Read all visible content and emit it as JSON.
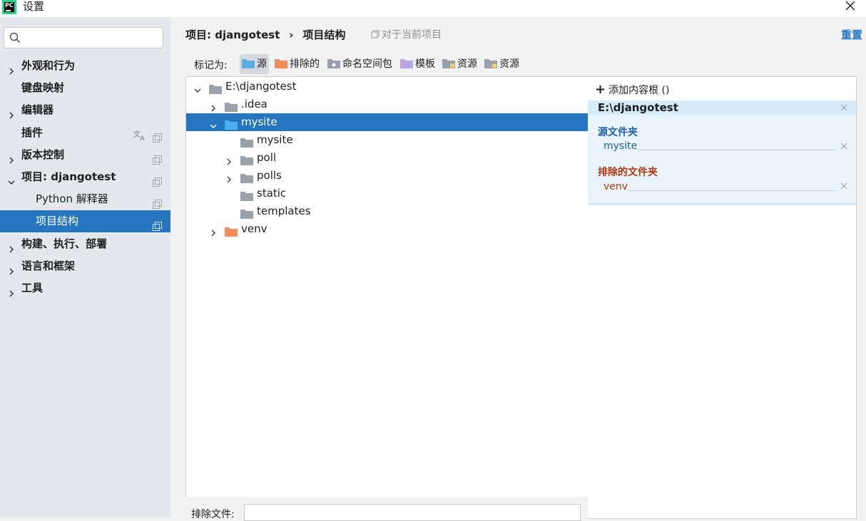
{
  "window": {
    "title": "设置"
  },
  "colors": {
    "accent": "#2675bf",
    "source_folder": "#3a97d4",
    "excluded_folder": "#f08d5a",
    "plain_folder": "#9aa1a8",
    "template_folder": "#b39ddb"
  },
  "sidebar": {
    "search_placeholder": "",
    "items": [
      {
        "label": "外观和行为",
        "expandable": true
      },
      {
        "label": "键盘映射",
        "expandable": false
      },
      {
        "label": "编辑器",
        "expandable": true
      },
      {
        "label": "插件",
        "expandable": false
      },
      {
        "label": "版本控制",
        "expandable": true
      },
      {
        "label": "项目: djangotest",
        "expandable": true,
        "expanded": true
      },
      {
        "label": "Python 解释器",
        "sub": true
      },
      {
        "label": "项目结构",
        "sub": true,
        "selected": true
      },
      {
        "label": "构建、执行、部署",
        "expandable": true
      },
      {
        "label": "语言和框架",
        "expandable": true
      },
      {
        "label": "工具",
        "expandable": true
      }
    ]
  },
  "header": {
    "breadcrumb_project": "项目: djangotest",
    "breadcrumb_separator": "›",
    "breadcrumb_page": "项目结构",
    "current_project_note": "对于当前项目",
    "reset_label": "重置"
  },
  "mark_as": {
    "label": "标记为:",
    "buttons": [
      {
        "label": "源",
        "icon": "source-folder-icon",
        "active": true
      },
      {
        "label": "排除的",
        "icon": "excluded-folder-icon"
      },
      {
        "label": "命名空间包",
        "icon": "namespace-folder-icon"
      },
      {
        "label": "模板",
        "icon": "template-folder-icon"
      },
      {
        "label": "资源",
        "icon": "resource-folder-icon"
      },
      {
        "label": "资源",
        "icon": "test-resource-folder-icon"
      }
    ]
  },
  "tree": {
    "rows": [
      {
        "label": "E:\\djangotest",
        "depth": 0,
        "chevron": "down",
        "folder": "plain"
      },
      {
        "label": ".idea",
        "depth": 1,
        "chevron": "right",
        "folder": "plain"
      },
      {
        "label": "mysite",
        "depth": 1,
        "chevron": "down",
        "folder": "source",
        "selected": true
      },
      {
        "label": "mysite",
        "depth": 2,
        "chevron": "none",
        "folder": "plain"
      },
      {
        "label": "poll",
        "depth": 2,
        "chevron": "right",
        "folder": "plain"
      },
      {
        "label": "polls",
        "depth": 2,
        "chevron": "right",
        "folder": "plain"
      },
      {
        "label": "static",
        "depth": 2,
        "chevron": "none",
        "folder": "plain"
      },
      {
        "label": "templates",
        "depth": 2,
        "chevron": "none",
        "folder": "plain"
      },
      {
        "label": "venv",
        "depth": 1,
        "chevron": "right",
        "folder": "excluded"
      }
    ]
  },
  "exclude_files": {
    "label": "排除文件:",
    "value": ""
  },
  "content_root": {
    "add_label": "添加内容根 ()",
    "root_path": "E:\\djangotest",
    "source_section_title": "源文件夹",
    "source_entry": "mysite",
    "excluded_section_title": "排除的文件夹",
    "excluded_entry": "venv"
  }
}
